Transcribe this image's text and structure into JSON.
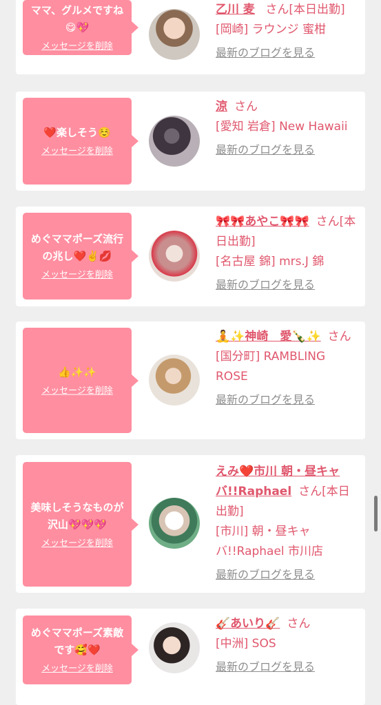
{
  "cards": [
    {
      "message": "ママ、グルメですね😋💖",
      "delete_label": "メッセージを削除",
      "name": "乙川 麦",
      "honorific": "さん",
      "status": "[本日出勤]",
      "location": "[岡崎] ラウンジ 蜜柑",
      "blog_link": "最新のブログを見る"
    },
    {
      "message": "❤️楽しそう☺️",
      "delete_label": "メッセージを削除",
      "name": "涼",
      "honorific": "さん",
      "status": "",
      "location": "[愛知 岩倉] New Hawaii",
      "blog_link": "最新のブログを見る"
    },
    {
      "message": "めぐママポーズ流行の兆し❤️✌️💋",
      "delete_label": "メッセージを削除",
      "name": "🎀🎀あやこ🎀🎀",
      "honorific": "さん",
      "status": "[本日出勤]",
      "location": "[名古屋 錦] mrs.J 錦",
      "blog_link": "最新のブログを見る"
    },
    {
      "message": "👍✨✨",
      "delete_label": "メッセージを削除",
      "name": "🧘✨神崎　愛🍾✨",
      "honorific": "さん",
      "status": "",
      "location": "[国分町] RAMBLING ROSE",
      "blog_link": "最新のブログを見る"
    },
    {
      "message": "美味しそうなものが沢山💖💖💖",
      "delete_label": "メッセージを削除",
      "name": "えみ❤️市川 朝・昼キャバ!!Raphael",
      "honorific": "さん",
      "status": "[本日出勤]",
      "location": "[市川] 朝・昼キャバ!!Raphael 市川店",
      "blog_link": "最新のブログを見る"
    },
    {
      "message": "めぐママポーズ素敵です🥰❤️",
      "delete_label": "メッセージを削除",
      "name": "🎸あいり🎸",
      "honorific": "さん",
      "status": "",
      "location": "[中洲] SOS",
      "blog_link": "最新のブログを見る"
    }
  ],
  "colors": {
    "accent_pink": "#ff8ea0",
    "name_pink": "#e0576d",
    "link_gray": "#8e8e8e",
    "background": "#efefef"
  }
}
